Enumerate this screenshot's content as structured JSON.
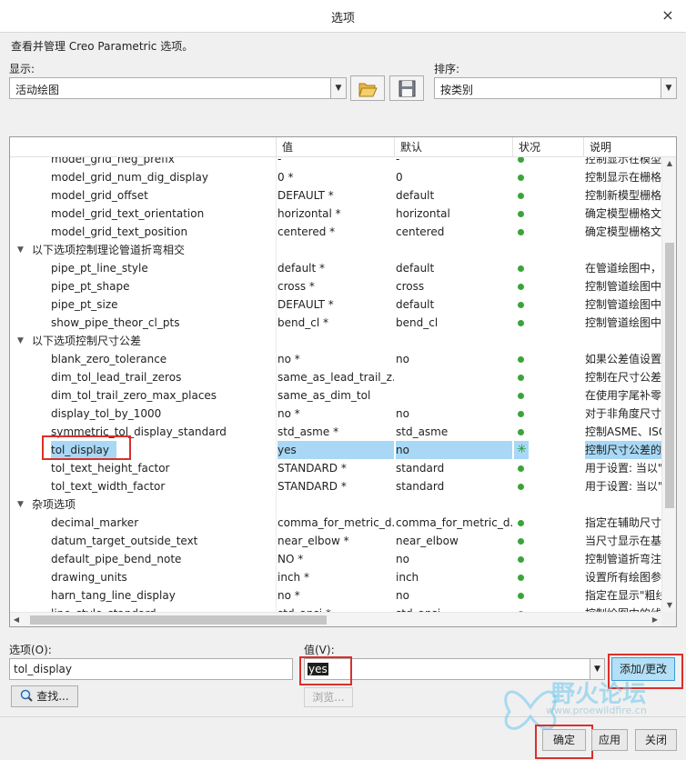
{
  "window": {
    "title": "选项",
    "close_glyph": "×"
  },
  "description": "查看并管理 Creo Parametric 选项。",
  "display": {
    "label": "显示:",
    "value": "活动绘图"
  },
  "sort": {
    "label": "排序:",
    "value": "按类别"
  },
  "table": {
    "headers": [
      "值",
      "默认",
      "状况",
      "说明"
    ],
    "rows": [
      {
        "type": "item",
        "name": "model_grid_neg_prefix",
        "value": "-",
        "default": "-",
        "status": "dot",
        "desc": "控制显示在模型"
      },
      {
        "type": "item",
        "name": "model_grid_num_dig_display",
        "value": "0 *",
        "default": "0",
        "status": "dot",
        "desc": "控制显示在栅格"
      },
      {
        "type": "item",
        "name": "model_grid_offset",
        "value": "DEFAULT *",
        "default": "default",
        "status": "dot",
        "desc": "控制新模型栅格"
      },
      {
        "type": "item",
        "name": "model_grid_text_orientation",
        "value": "horizontal *",
        "default": "horizontal",
        "status": "dot",
        "desc": "确定模型栅格文"
      },
      {
        "type": "item",
        "name": "model_grid_text_position",
        "value": "centered *",
        "default": "centered",
        "status": "dot",
        "desc": "确定模型栅格文"
      },
      {
        "type": "group",
        "name": "以下选项控制理论管道折弯相交"
      },
      {
        "type": "item",
        "name": "pipe_pt_line_style",
        "value": "default *",
        "default": "default",
        "status": "dot",
        "desc": "在管道绘图中，"
      },
      {
        "type": "item",
        "name": "pipe_pt_shape",
        "value": "cross *",
        "default": "cross",
        "status": "dot",
        "desc": "控制管道绘图中"
      },
      {
        "type": "item",
        "name": "pipe_pt_size",
        "value": "DEFAULT *",
        "default": "default",
        "status": "dot",
        "desc": "控制管道绘图中"
      },
      {
        "type": "item",
        "name": "show_pipe_theor_cl_pts",
        "value": "bend_cl *",
        "default": "bend_cl",
        "status": "dot",
        "desc": "控制管道绘图中"
      },
      {
        "type": "group",
        "name": "以下选项控制尺寸公差"
      },
      {
        "type": "item",
        "name": "blank_zero_tolerance",
        "value": "no *",
        "default": "no",
        "status": "dot",
        "desc": "如果公差值设置"
      },
      {
        "type": "item",
        "name": "dim_tol_lead_trail_zeros",
        "value": "same_as_lead_trail_z...",
        "default": "",
        "status": "dot",
        "desc": "控制在尺寸公差"
      },
      {
        "type": "item",
        "name": "dim_tol_trail_zero_max_places",
        "value": "same_as_dim_tol",
        "default": "",
        "status": "dot",
        "desc": "在使用字尾补零"
      },
      {
        "type": "item",
        "name": "display_tol_by_1000",
        "value": "no *",
        "default": "no",
        "status": "dot",
        "desc": "对于非角度尺寸"
      },
      {
        "type": "item",
        "name": "symmetric_tol_display_standard",
        "value": "std_asme *",
        "default": "std_asme",
        "status": "dot",
        "desc": "控制ASME、ISO"
      },
      {
        "type": "item",
        "name": "tol_display",
        "value": "yes",
        "default": "no",
        "status": "star",
        "desc": "控制尺寸公差的",
        "selected": true
      },
      {
        "type": "item",
        "name": "tol_text_height_factor",
        "value": "STANDARD *",
        "default": "standard",
        "status": "dot",
        "desc": "用于设置: 当以\""
      },
      {
        "type": "item",
        "name": "tol_text_width_factor",
        "value": "STANDARD *",
        "default": "standard",
        "status": "dot",
        "desc": "用于设置: 当以\""
      },
      {
        "type": "group",
        "name": "杂项选项"
      },
      {
        "type": "item",
        "name": "decimal_marker",
        "value": "comma_for_metric_d...",
        "default": "comma_for_metric_d...",
        "status": "dot",
        "desc": "指定在辅助尺寸"
      },
      {
        "type": "item",
        "name": "datum_target_outside_text",
        "value": "near_elbow *",
        "default": "near_elbow",
        "status": "dot",
        "desc": "当尺寸显示在基"
      },
      {
        "type": "item",
        "name": "default_pipe_bend_note",
        "value": "NO *",
        "default": "no",
        "status": "dot",
        "desc": "控制管道折弯注"
      },
      {
        "type": "item",
        "name": "drawing_units",
        "value": "inch *",
        "default": "inch",
        "status": "dot",
        "desc": "设置所有绘图参"
      },
      {
        "type": "item",
        "name": "harn_tang_line_display",
        "value": "no *",
        "default": "no",
        "status": "dot",
        "desc": "指定在显示\"粗线"
      },
      {
        "type": "item",
        "name": "line_style_standard",
        "value": "std_ansi *",
        "default": "std_ansi",
        "status": "dot",
        "desc": "控制绘图中的线"
      }
    ]
  },
  "option_field": {
    "label": "选项(O):",
    "value": "tol_display"
  },
  "value_field": {
    "label": "值(V):",
    "value": "yes"
  },
  "buttons": {
    "add_change": "添加/更改",
    "find": "查找...",
    "browse": "浏览...",
    "ok": "确定",
    "apply": "应用",
    "close": "关闭"
  },
  "watermark": {
    "text": "野火论坛",
    "url": "www.proewildfire.cn"
  },
  "colors": {
    "accent": "#b3e0f7",
    "highlight": "#a8d8f5",
    "annotation": "#d9302c",
    "status_ok": "#3aa43a"
  }
}
